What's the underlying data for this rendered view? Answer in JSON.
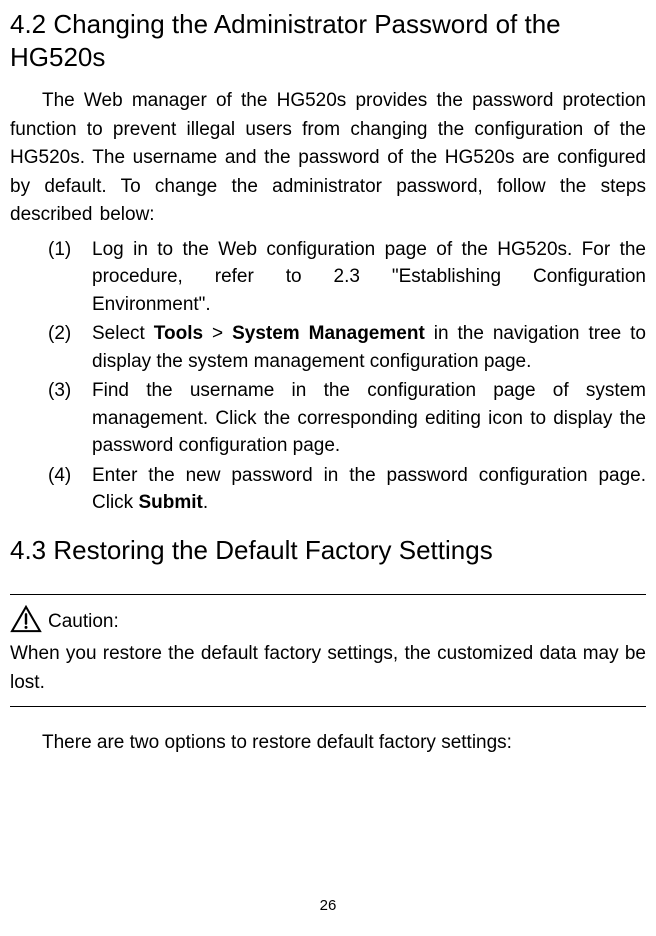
{
  "section42": {
    "heading": "4.2  Changing the Administrator Password of the HG520s",
    "intro": "The Web manager of the HG520s provides the password protection function to prevent illegal users from changing the configuration of the HG520s. The username and the password of the HG520s are configured by default. To change the administrator password, follow the steps described below:",
    "steps": [
      {
        "pre": "Log in to the Web configuration page of the HG520s. For the procedure, refer to 2.3  \"Establishing Configuration Environment\"."
      },
      {
        "pre": "Select ",
        "bold1": "Tools",
        "mid1": " > ",
        "bold2": "System Management",
        "post": " in the navigation tree to display the system management configuration page."
      },
      {
        "pre": "Find the username in the configuration page of system management. Click the corresponding editing icon to display the password configuration page."
      },
      {
        "pre": "Enter the new password in the password configuration page. Click ",
        "bold1": "Submit",
        "post": "."
      }
    ]
  },
  "section43": {
    "heading": "4.3  Restoring the Default Factory Settings",
    "caution": {
      "label": "Caution:",
      "text": "When you restore the default factory settings, the customized data may be lost."
    },
    "after": "There are two options to restore default factory settings:"
  },
  "page_number": "26"
}
